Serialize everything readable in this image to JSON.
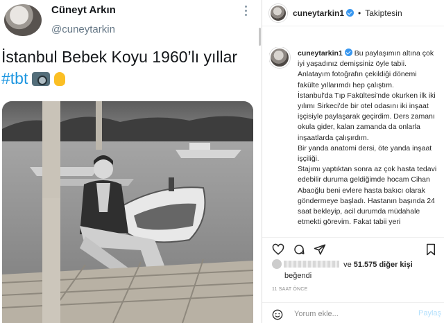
{
  "tweet": {
    "name": "Cüneyt Arkın",
    "handle": "@cuneytarkin",
    "text": "İstanbul Bebek Koyu 1960’lı yıllar",
    "hashtag": "#tbt",
    "icons": [
      "camera-with-flash-emoji",
      "ok-hand-emoji"
    ]
  },
  "instagram": {
    "username": "cuneytarkin1",
    "follow_status": "Takiptesin",
    "separator": "•",
    "caption_user": "cuneytarkin1",
    "caption_paragraphs": [
      "Bu paylaşımın altına çok iyi yaşadınız demişsiniz öyle tabii. Anlatayım fotoğrafın çekildiği dönemi fakülte yıllarımdı hep çalıştım.",
      "İstanbul'da Tıp Fakültesi'nde okurken ilk iki yılımı Sirkeci'de bir otel odasını iki inşaat işçisiyle paylaşarak geçirdim. Ders zamanı okula gider, kalan zamanda da onlarla inşaatlarda çalışırdım.",
      "Bir yanda anatomi dersi, öte yanda inşaat işçiliği.",
      "Stajımı yaptıktan sonra az çok hasta tedavi edebilir duruma geldiğimde hocam Cihan Abaoğlu beni evlere hasta bakıcı olarak göndermeye başladı. Hastanın başında 24 saat bekleyip, acil durumda müdahale etmekti görevim. Fakat tabii yeri"
    ],
    "likes_prefix": "ve",
    "likes_count": "51.575 diğer kişi",
    "likes_suffix": "beğendi",
    "time": "11 SAAT ÖNCE",
    "comment_placeholder": "Yorum ekle...",
    "post_label": "Paylaş",
    "colors": {
      "link": "#1b95e0",
      "verified": "#3897f0",
      "post_disabled": "#b2dffc"
    }
  }
}
